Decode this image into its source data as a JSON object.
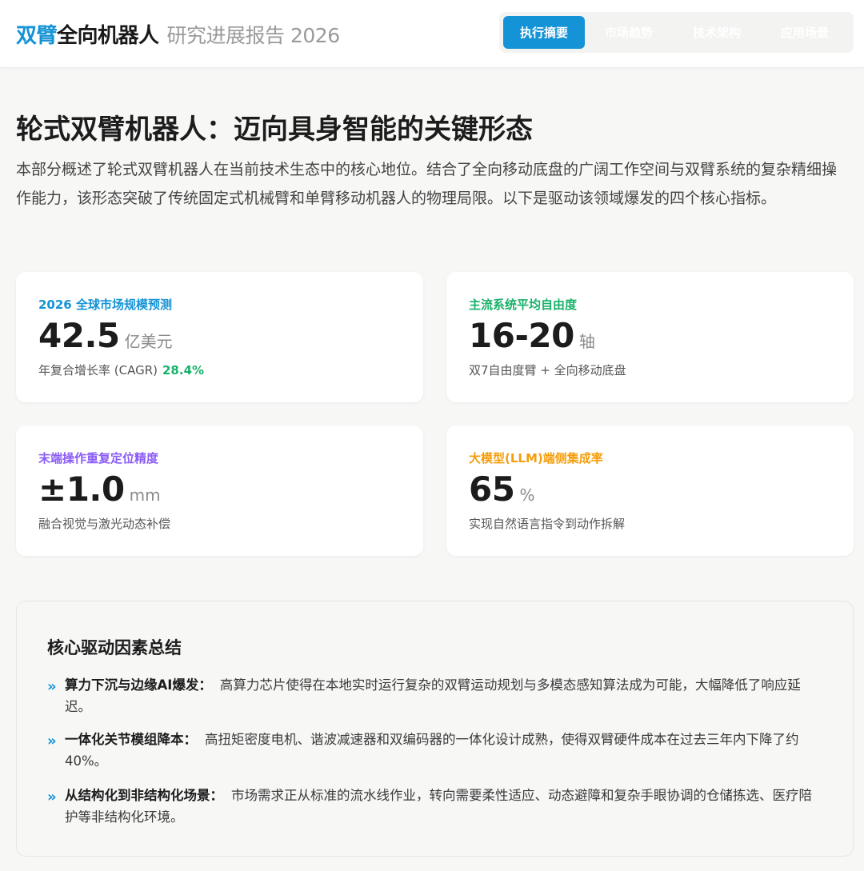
{
  "header": {
    "logo_accent": "双臂",
    "logo_main": "全向机器人",
    "logo_sub": "研究进展报告 2026",
    "tabs": [
      {
        "label": "执行摘要",
        "active": true
      },
      {
        "label": "市场趋势",
        "active": false
      },
      {
        "label": "技术架构",
        "active": false
      },
      {
        "label": "应用场景",
        "active": false
      }
    ]
  },
  "main": {
    "title": "轮式双臂机器人：迈向具身智能的关键形态",
    "intro": "本部分概述了轮式双臂机器人在当前技术生态中的核心地位。结合了全向移动底盘的广阔工作空间与双臂系统的复杂精细操作能力，该形态突破了传统固定式机械臂和单臂移动机器人的物理局限。以下是驱动该领域爆发的四个核心指标。"
  },
  "metrics": [
    {
      "label": "2026 全球市场规模预测",
      "value": "42.5",
      "unit": "亿美元",
      "note": "年复合增长率 (CAGR)",
      "highlight": "28.4%",
      "color": "#1493d6"
    },
    {
      "label": "主流系统平均自由度",
      "value": "16-20",
      "unit": "轴",
      "note": "双7自由度臂 + 全向移动底盘",
      "highlight": "",
      "color": "#17b26a"
    },
    {
      "label": "末端操作重复定位精度",
      "value": "±1.0",
      "unit": "mm",
      "note": "融合视觉与激光动态补偿",
      "highlight": "",
      "color": "#8b5cf6"
    },
    {
      "label": "大模型(LLM)端侧集成率",
      "value": "65",
      "unit": "%",
      "note": "实现自然语言指令到动作拆解",
      "highlight": "",
      "color": "#f59e0b"
    }
  ],
  "summary": {
    "title": "核心驱动因素总结",
    "bullet_icon": "»",
    "items": [
      {
        "head": "算力下沉与边缘AI爆发：",
        "body": "高算力芯片使得在本地实时运行复杂的双臂运动规划与多模态感知算法成为可能，大幅降低了响应延迟。"
      },
      {
        "head": "一体化关节模组降本：",
        "body": "高扭矩密度电机、谐波减速器和双编码器的一体化设计成熟，使得双臂硬件成本在过去三年内下降了约40%。"
      },
      {
        "head": "从结构化到非结构化场景：",
        "body": "市场需求正从标准的流水线作业，转向需要柔性适应、动态避障和复杂手眼协调的仓储拣选、医疗陪护等非结构化环境。"
      }
    ]
  }
}
